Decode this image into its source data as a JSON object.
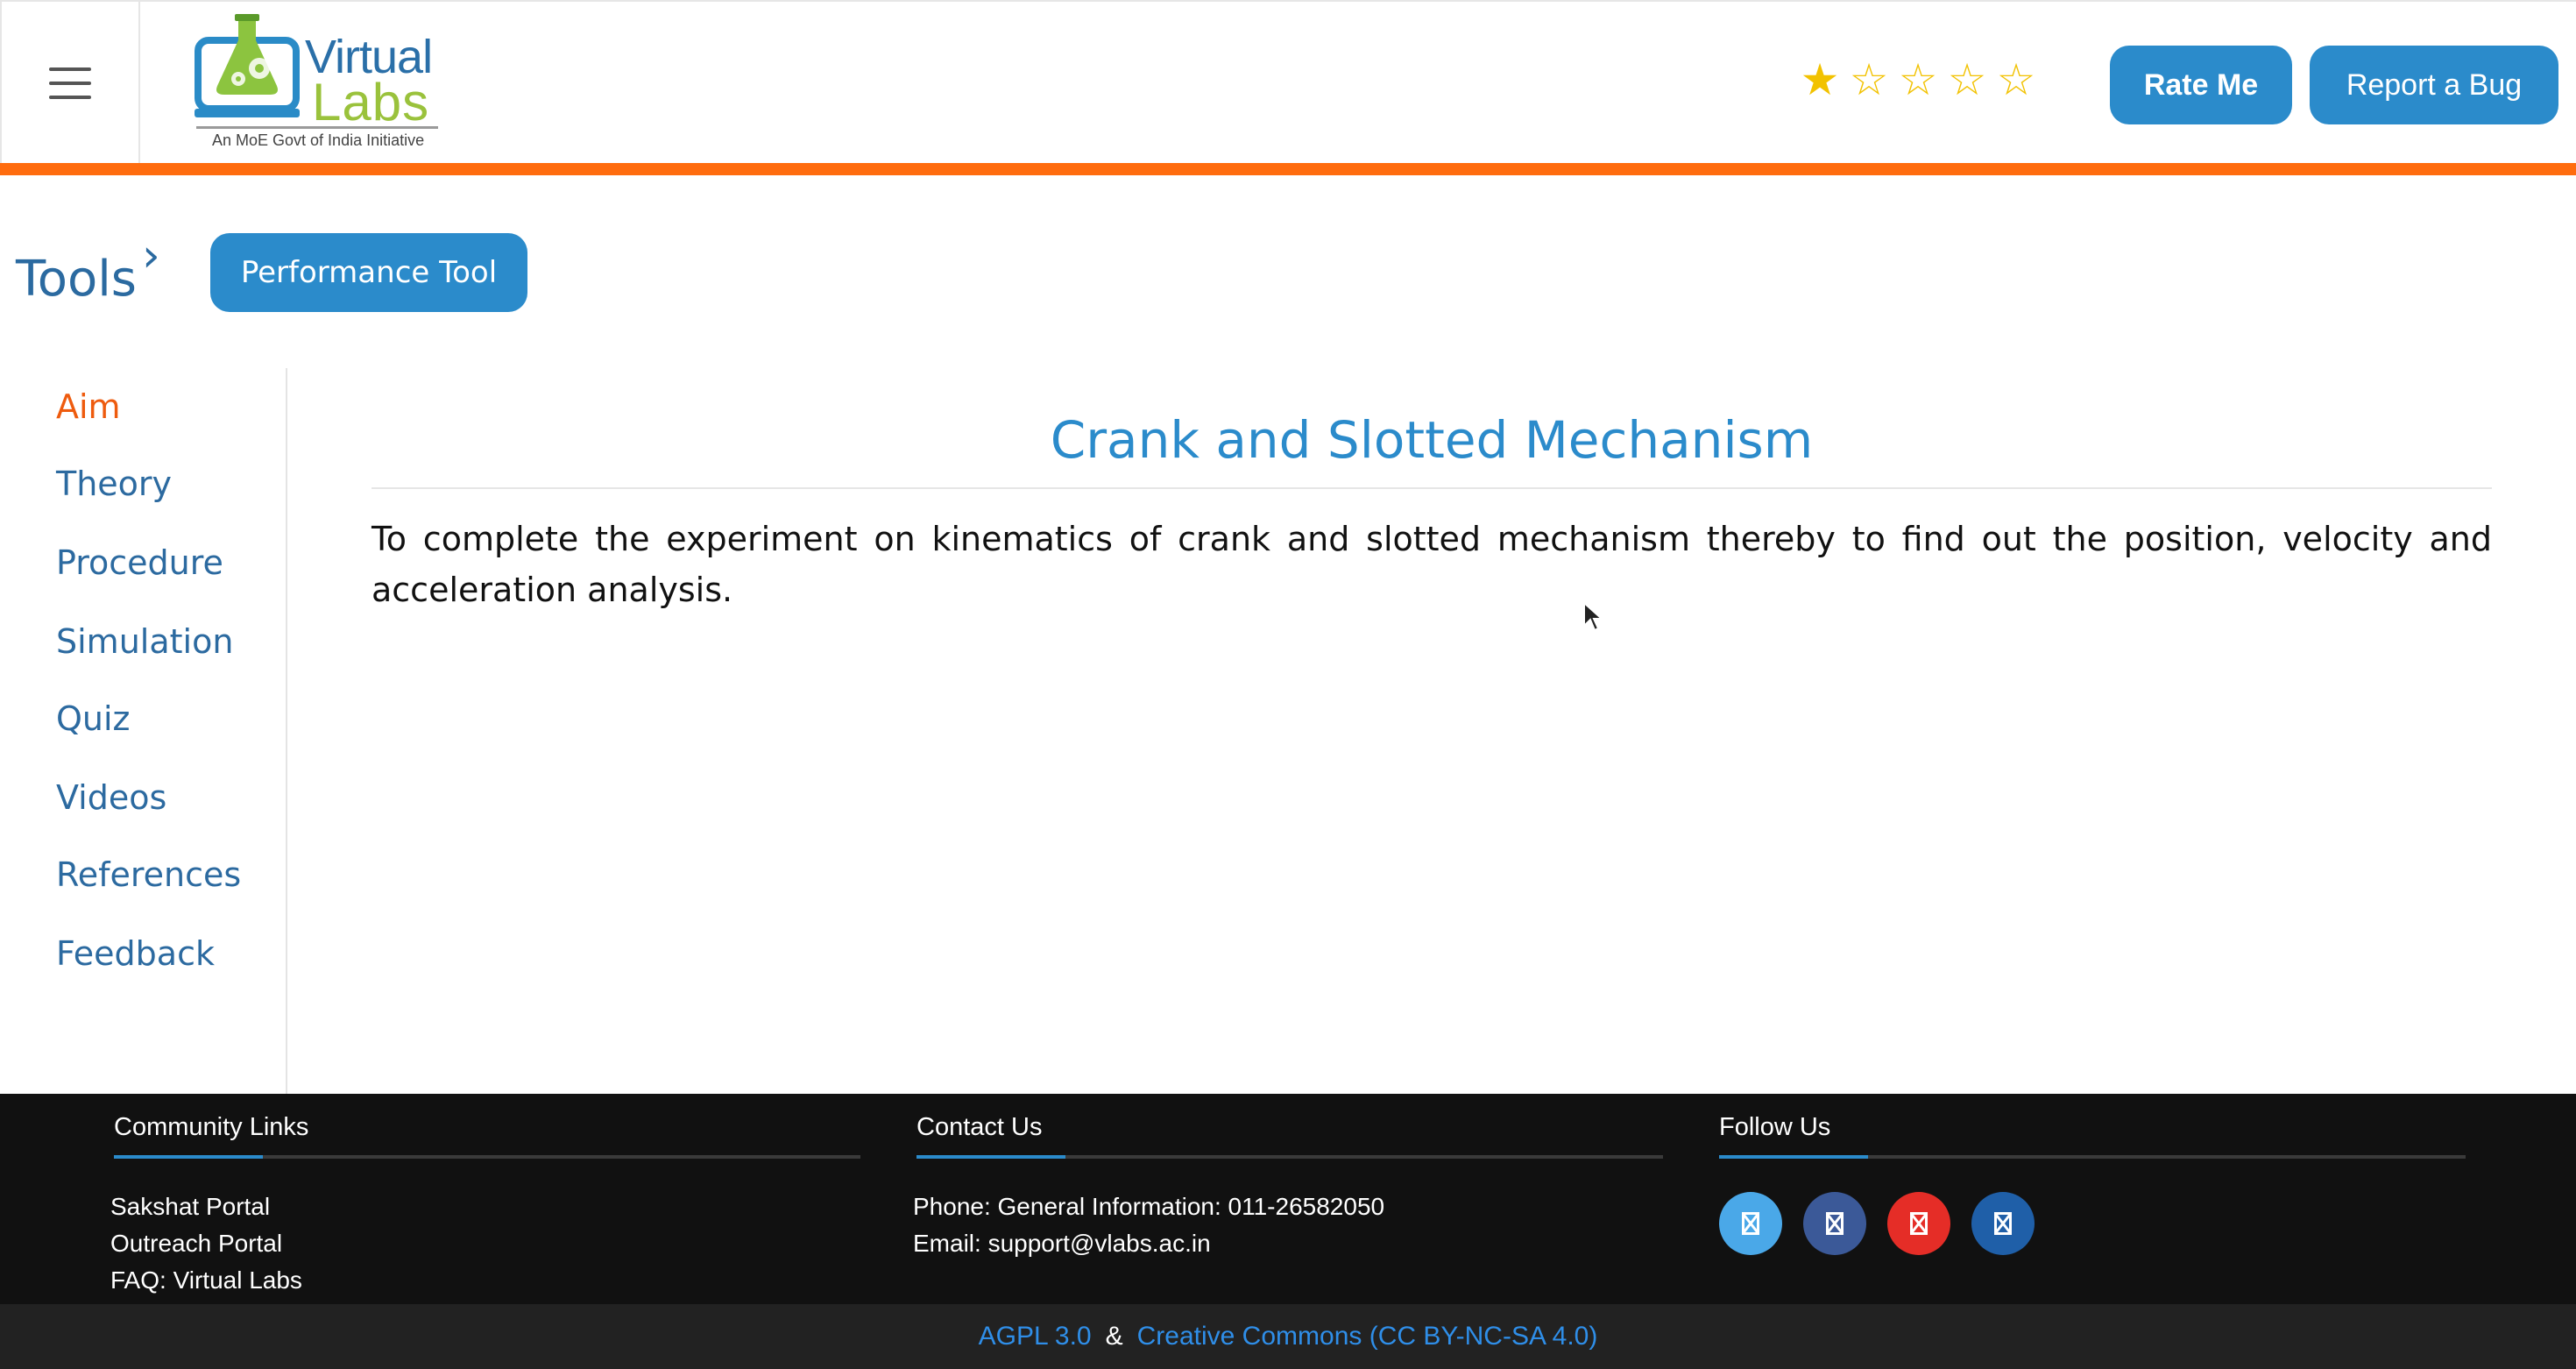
{
  "header": {
    "logo": {
      "line1": "Virtual",
      "line2": "Labs",
      "tagline": "An MoE Govt of India Initiative"
    },
    "rating": {
      "value": 1,
      "max": 5,
      "star_color": "#f2c200"
    },
    "rate_button": "Rate Me",
    "bug_button": "Report a Bug",
    "accent_color": "#ff6c0e"
  },
  "breadcrumb": {
    "root": "Tools",
    "separator_icon": "chevron-right-icon",
    "current": "Performance Tool"
  },
  "sidebar": {
    "items": [
      {
        "label": "Aim",
        "active": true
      },
      {
        "label": "Theory",
        "active": false
      },
      {
        "label": "Procedure",
        "active": false
      },
      {
        "label": "Simulation",
        "active": false
      },
      {
        "label": "Quiz",
        "active": false
      },
      {
        "label": "Videos",
        "active": false
      },
      {
        "label": "References",
        "active": false
      },
      {
        "label": "Feedback",
        "active": false
      }
    ]
  },
  "main": {
    "title": "Crank and Slotted Mechanism",
    "text": "To complete the experiment on kinematics of crank and slotted mechanism thereby to find out the position, velocity and acceleration analysis."
  },
  "footer": {
    "community": {
      "heading": "Community Links",
      "links": [
        "Sakshat Portal",
        "Outreach Portal",
        "FAQ: Virtual Labs"
      ]
    },
    "contact": {
      "heading": "Contact Us",
      "lines": [
        "Phone: General Information: 011-26582050",
        "Email: support@vlabs.ac.in"
      ]
    },
    "follow": {
      "heading": "Follow Us",
      "icons": [
        {
          "name": "twitter-icon",
          "color": "#4aa8e8"
        },
        {
          "name": "facebook-icon",
          "color": "#3b5998"
        },
        {
          "name": "youtube-icon",
          "color": "#e52d27"
        },
        {
          "name": "linkedin-icon",
          "color": "#1f5fa8"
        }
      ]
    },
    "license": {
      "link1": "AGPL 3.0",
      "separator": "&",
      "link2": "Creative Commons (CC BY-NC-SA 4.0)"
    }
  }
}
